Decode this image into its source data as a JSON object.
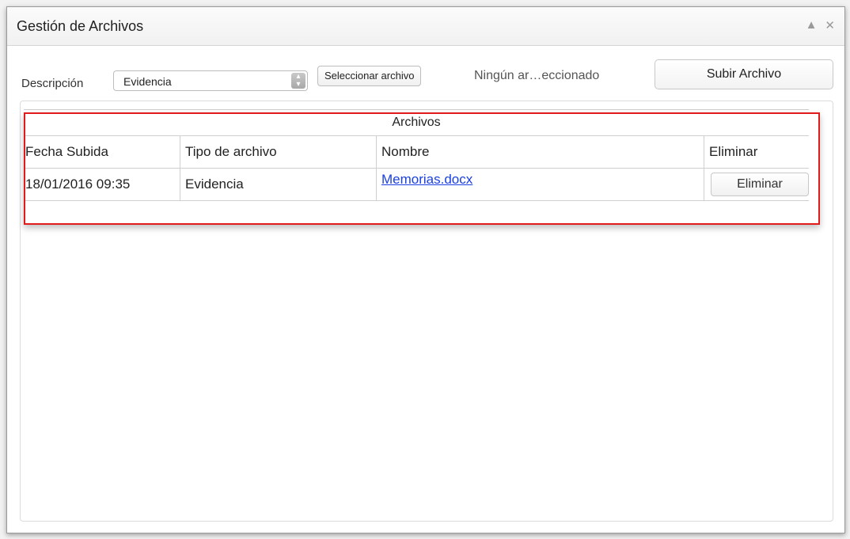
{
  "dialog": {
    "title": "Gestión de Archivos",
    "controls": {
      "collapse_icon": "▲",
      "close_icon": "✕"
    }
  },
  "toolbar": {
    "description_label": "Descripción",
    "description_select": {
      "value": "Evidencia"
    },
    "file_button_label": "Seleccionar archivo",
    "file_status": "Ningún ar…eccionado",
    "upload_button_label": "Subir Archivo"
  },
  "grid": {
    "caption": "Archivos",
    "columns": [
      "Fecha Subida",
      "Tipo de archivo",
      "Nombre",
      "Eliminar"
    ],
    "rows": [
      {
        "date": "18/01/2016 09:35",
        "type": "Evidencia",
        "name": "Memorias.docx",
        "delete_label": "Eliminar"
      }
    ]
  },
  "colors": {
    "link": "#1a3fe0",
    "highlight": "#e11b1b"
  }
}
